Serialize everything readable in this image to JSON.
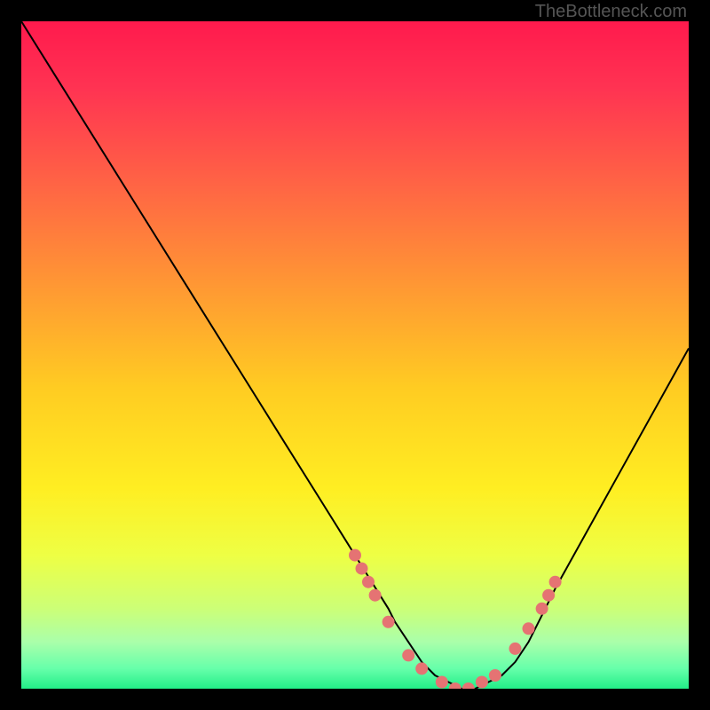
{
  "watermark": "TheBottleneck.com",
  "chart_data": {
    "type": "line",
    "title": "",
    "xlabel": "",
    "ylabel": "",
    "xlim": [
      0,
      100
    ],
    "ylim": [
      0,
      100
    ],
    "series": [
      {
        "name": "bottleneck-curve",
        "x": [
          0,
          5,
          10,
          15,
          20,
          25,
          30,
          35,
          40,
          45,
          50,
          55,
          56,
          58,
          60,
          62,
          64,
          66,
          68,
          70,
          72,
          74,
          76,
          78,
          80,
          85,
          90,
          95,
          100
        ],
        "y": [
          100,
          92,
          84,
          76,
          68,
          60,
          52,
          44,
          36,
          28,
          20,
          12,
          10,
          7,
          4,
          2,
          1,
          0,
          0,
          1,
          2,
          4,
          7,
          11,
          15,
          24,
          33,
          42,
          51
        ]
      }
    ],
    "dot_markers": {
      "name": "pink-dots",
      "x": [
        50,
        51,
        52,
        53,
        55,
        58,
        60,
        63,
        65,
        67,
        69,
        71,
        74,
        76,
        78,
        79,
        80
      ],
      "y": [
        20,
        18,
        16,
        14,
        10,
        5,
        3,
        1,
        0,
        0,
        1,
        2,
        6,
        9,
        12,
        14,
        16
      ]
    },
    "gradient_stops": [
      {
        "offset": 0.0,
        "color": "#ff1a4d"
      },
      {
        "offset": 0.1,
        "color": "#ff3352"
      },
      {
        "offset": 0.25,
        "color": "#ff6644"
      },
      {
        "offset": 0.4,
        "color": "#ff9933"
      },
      {
        "offset": 0.55,
        "color": "#ffcc22"
      },
      {
        "offset": 0.7,
        "color": "#ffee22"
      },
      {
        "offset": 0.8,
        "color": "#eeff44"
      },
      {
        "offset": 0.88,
        "color": "#ccff77"
      },
      {
        "offset": 0.93,
        "color": "#aaffaa"
      },
      {
        "offset": 0.97,
        "color": "#66ffaa"
      },
      {
        "offset": 1.0,
        "color": "#22ee88"
      }
    ]
  }
}
